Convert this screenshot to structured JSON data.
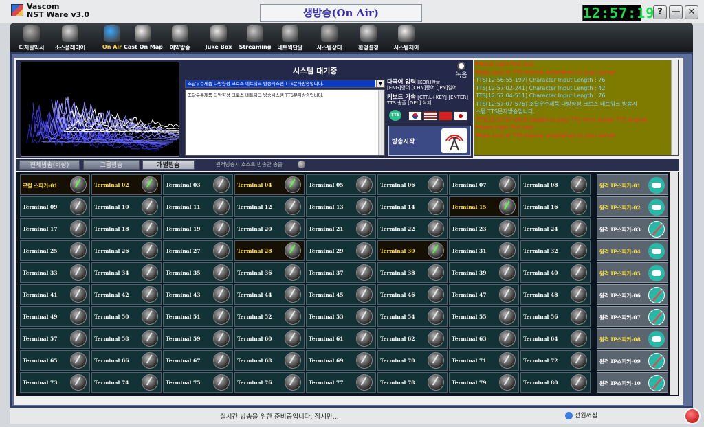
{
  "app": {
    "name": "Vascom",
    "subtitle": "NST Ware v3.0",
    "title": "생방송(On Air)",
    "clock": "12:57:19"
  },
  "window": {
    "help": "?",
    "minimize": "—",
    "close": "✕"
  },
  "toolbar": [
    {
      "label": "디지탈믹서",
      "icon": "mixer-icon"
    },
    {
      "label": "소스플레이어",
      "icon": "player-icon"
    },
    {
      "label": "On Air",
      "icon": "broadcast-icon",
      "active": true
    },
    {
      "label": "Cast On Map",
      "icon": "map-icon"
    },
    {
      "label": "예약방송",
      "icon": "schedule-icon"
    },
    {
      "label": "Juke Box",
      "icon": "jukebox-icon"
    },
    {
      "label": "Streaming",
      "icon": "streaming-icon"
    },
    {
      "label": "네트웍단말",
      "icon": "network-icon"
    },
    {
      "label": "시스템상태",
      "icon": "monitor-icon"
    },
    {
      "label": "환경설정",
      "icon": "settings-icon"
    },
    {
      "label": "시스템제어",
      "icon": "control-icon"
    }
  ],
  "panel": {
    "system_state": "시스템 대기중",
    "record_label": "녹음",
    "tts_selected": "조달우수제품 다방향성 크로스 네트워크 방송시스템 TTS문자방송입니다.",
    "tts_text": "조달우수제품 다방향성 크로스 네트워크 방송시스템 TTS문자방송입니다.",
    "help_lang_title": "다국어 입력",
    "help_lang_detail": " [KOR]한글",
    "help_lang_line2": "[ENG]영어 [CHN]중어 [JPN]일어",
    "help_key_title": "키보드 가속",
    "help_key_detail": " [CTRL+KEY]-[ENTER]",
    "help_key_line2": "TTS 송출 [DEL] 삭제",
    "tts_badge": "TTS",
    "onair_label": "방송시작"
  },
  "log": [
    {
      "text": "Please login first and",
      "color": "#ff2a2a"
    },
    {
      "text": "Make sure of TTS license installation in your server",
      "color": "#ff2a2a"
    },
    {
      "text": "TTS[12:56:55-197] Character Input Length : 76",
      "color": "#7fd4ff"
    },
    {
      "text": "TTS[12:57:02-241] Character Input Length : 42",
      "color": "#7fd4ff"
    },
    {
      "text": "TTS[12:57:04-511] Character Input Length : 76",
      "color": "#7fd4ff"
    },
    {
      "text": "TTS[12:57:07-576] 조달우수제품 다방향성 크로스 네트워크 방송시",
      "color": "#7fd4ff"
    },
    {
      "text": "스템 TTS문자방송입니다.",
      "color": "#7fd4ff"
    },
    {
      "text": "TTS[12:57:07-603] Unable to play TTS from server TTS engine",
      "color": "#ff2a2a"
    },
    {
      "text": "Please login first and",
      "color": "#ff2a2a"
    },
    {
      "text": "Make sure of TTS license installation in your server",
      "color": "#ff2a2a"
    }
  ],
  "tabs": [
    {
      "label": "전체방송(비상)"
    },
    {
      "label": "그룹방송"
    },
    {
      "label": "개별방송",
      "active": true
    }
  ],
  "remote_only_label": "원격방송시 호스트 방송만 송출",
  "terminals": [
    "로컬 스피커-01",
    "Terminal 02",
    "Terminal 03",
    "Terminal 04",
    "Terminal 05",
    "Terminal 06",
    "Terminal 07",
    "Terminal 08",
    "Terminal 09",
    "Terminal 10",
    "Terminal 11",
    "Terminal 12",
    "Terminal 13",
    "Terminal 14",
    "Terminal 15",
    "Terminal 16",
    "Terminal 17",
    "Terminal 18",
    "Terminal 19",
    "Terminal 20",
    "Terminal 21",
    "Terminal 22",
    "Terminal 23",
    "Terminal 24",
    "Terminal 25",
    "Terminal 26",
    "Terminal 27",
    "Terminal 28",
    "Terminal 29",
    "Terminal 30",
    "Terminal 31",
    "Terminal 32",
    "Terminal 33",
    "Terminal 34",
    "Terminal 35",
    "Terminal 36",
    "Terminal 37",
    "Terminal 38",
    "Terminal 39",
    "Terminal 40",
    "Terminal 41",
    "Terminal 42",
    "Terminal 43",
    "Terminal 44",
    "Terminal 45",
    "Terminal 46",
    "Terminal 47",
    "Terminal 48",
    "Terminal 49",
    "Terminal 50",
    "Terminal 51",
    "Terminal 52",
    "Terminal 53",
    "Terminal 54",
    "Terminal 55",
    "Terminal 56",
    "Terminal 57",
    "Terminal 58",
    "Terminal 59",
    "Terminal 60",
    "Terminal 61",
    "Terminal 62",
    "Terminal 63",
    "Terminal 64",
    "Terminal 65",
    "Terminal 66",
    "Terminal 67",
    "Terminal 68",
    "Terminal 69",
    "Terminal 70",
    "Terminal 71",
    "Terminal 72",
    "Terminal 73",
    "Terminal 74",
    "Terminal 75",
    "Terminal 76",
    "Terminal 77",
    "Terminal 78",
    "Terminal 79",
    "Terminal 80"
  ],
  "active_terminals": [
    1,
    2,
    4,
    15,
    28,
    30
  ],
  "ip_speakers": [
    {
      "label": "원격 IP스피커-01",
      "on": true,
      "status": "cloud"
    },
    {
      "label": "원격 IP스피커-02",
      "on": true,
      "status": "cloud"
    },
    {
      "label": "원격 IP스피커-03",
      "on": false,
      "status": "error"
    },
    {
      "label": "원격 IP스피커-04",
      "on": true,
      "status": "cloud"
    },
    {
      "label": "원격 IP스피커-05",
      "on": true,
      "status": "cloud"
    },
    {
      "label": "원격 IP스피커-06",
      "on": false,
      "status": "error"
    },
    {
      "label": "원격 IP스피커-07",
      "on": false,
      "status": "error"
    },
    {
      "label": "원격 IP스피커-08",
      "on": true,
      "status": "cloud"
    },
    {
      "label": "원격 IP스피커-09",
      "on": false,
      "status": "error"
    },
    {
      "label": "원격 IP스피커-10",
      "on": false,
      "status": "error"
    }
  ],
  "status": {
    "message": "실시간 방송을 위한 준비중입니다. 잠시만...",
    "volume_label": "전원꺼짐"
  }
}
